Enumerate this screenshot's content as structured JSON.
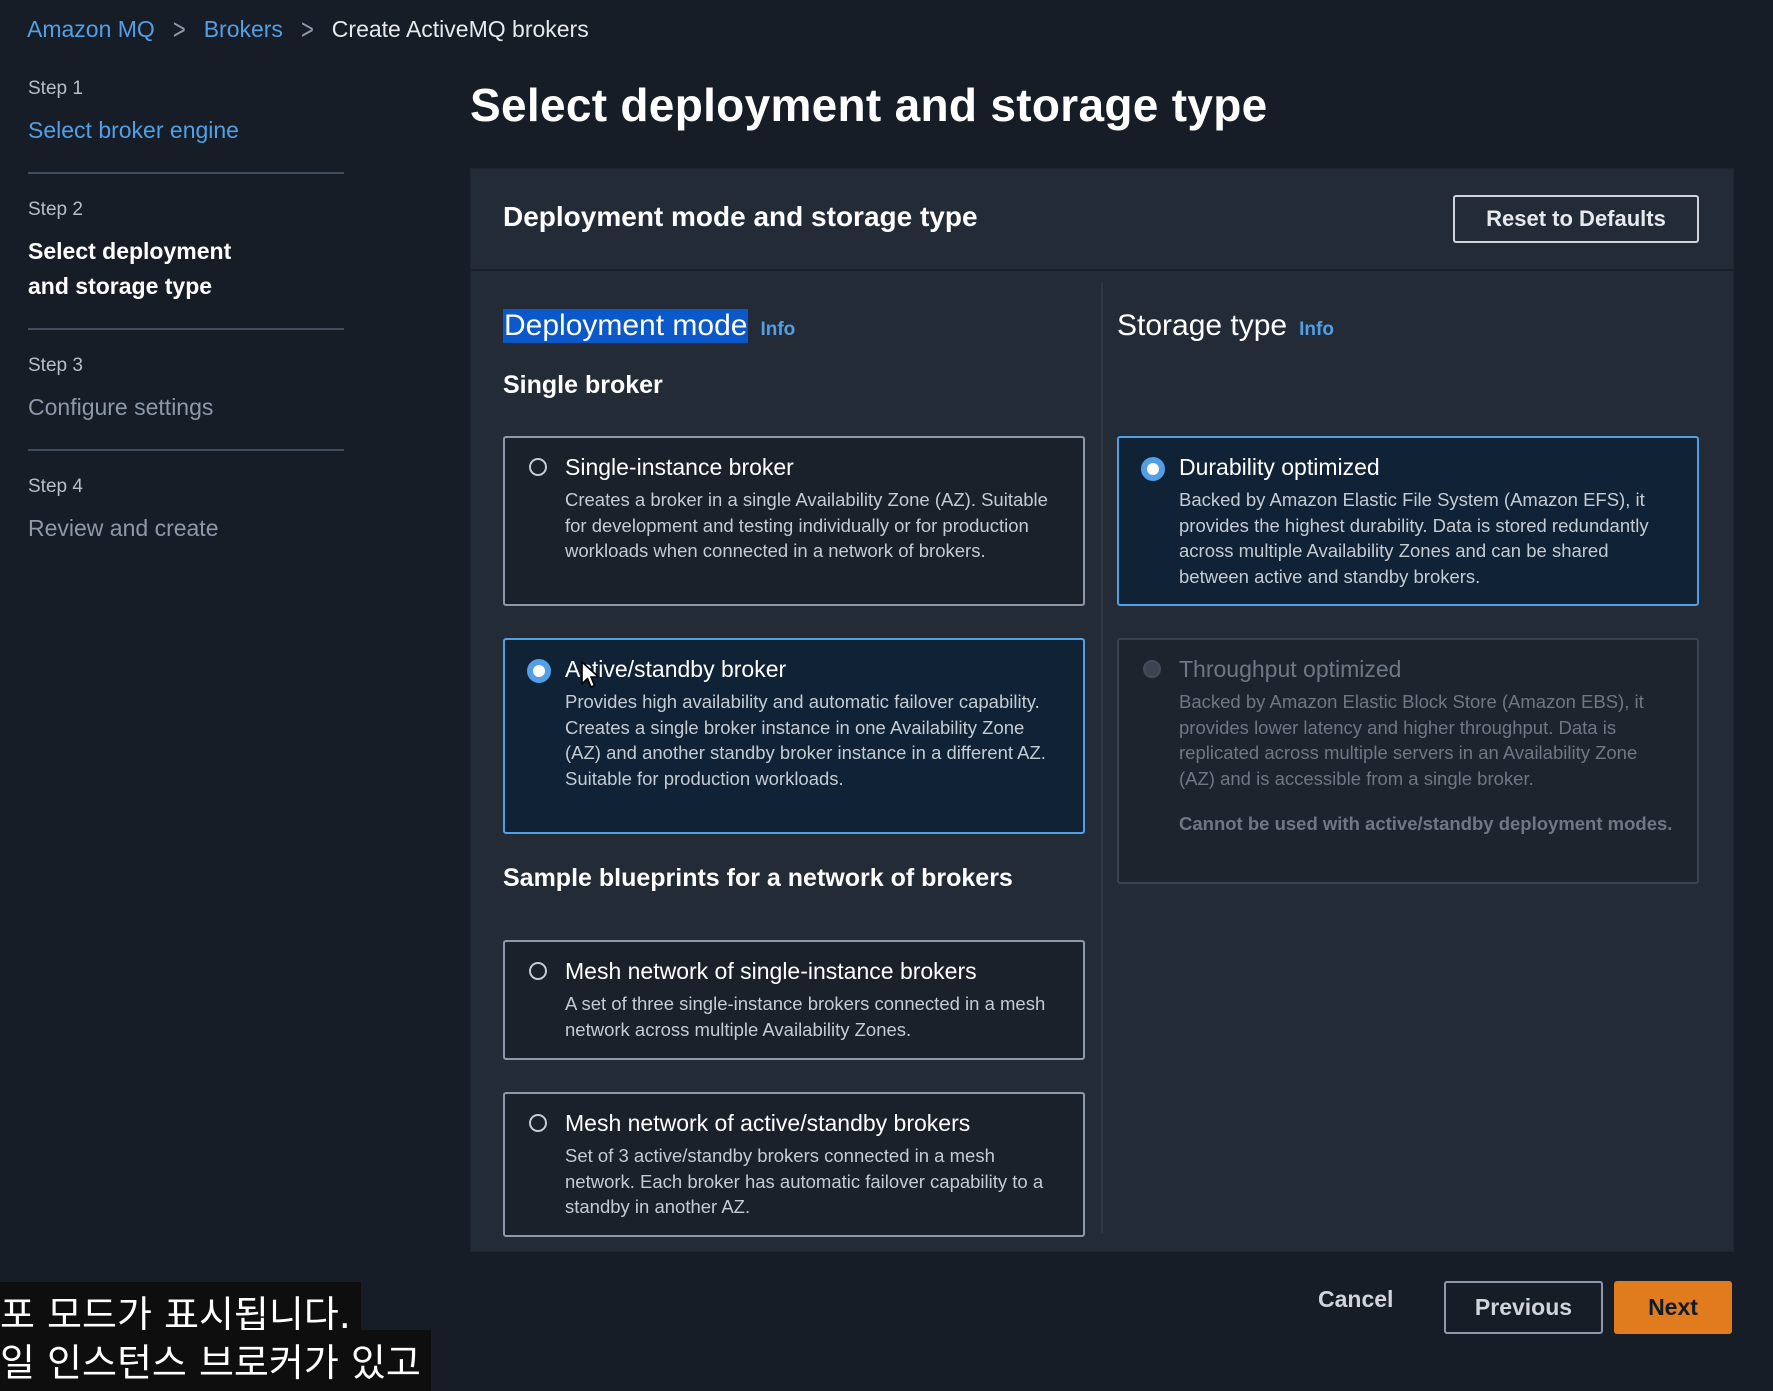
{
  "breadcrumb": {
    "items": [
      "Amazon MQ",
      "Brokers"
    ],
    "current": "Create ActiveMQ brokers"
  },
  "steps": [
    {
      "num": "Step 1",
      "title": "Select broker engine"
    },
    {
      "num": "Step 2",
      "title": "Select deployment and storage type"
    },
    {
      "num": "Step 3",
      "title": "Configure settings"
    },
    {
      "num": "Step 4",
      "title": "Review and create"
    }
  ],
  "page_title": "Select deployment and storage type",
  "container": {
    "title": "Deployment mode and storage type",
    "reset_label": "Reset to Defaults"
  },
  "deployment": {
    "label": "Deployment mode",
    "info": "Info",
    "single_head": "Single broker",
    "options": [
      {
        "title": "Single-instance broker",
        "desc": "Creates a broker in a single Availability Zone (AZ). Suitable for development and testing individually or for production workloads when connected in a network of brokers.",
        "selected": false
      },
      {
        "title": "Active/standby broker",
        "desc": "Provides high availability and automatic failover capability. Creates a single broker instance in one Availability Zone (AZ) and another standby broker instance in a different AZ. Suitable for production workloads.",
        "selected": true
      }
    ],
    "blueprint_head": "Sample blueprints for a network of brokers",
    "blueprints": [
      {
        "title": "Mesh network of single-instance brokers",
        "desc": "A set of three single-instance brokers connected in a mesh network across multiple Availability Zones.",
        "selected": false
      },
      {
        "title": "Mesh network of active/standby brokers",
        "desc": "Set of 3 active/standby brokers connected in a mesh network. Each broker has automatic failover capability to a standby in another AZ.",
        "selected": false
      }
    ]
  },
  "storage": {
    "label": "Storage type",
    "info": "Info",
    "options": [
      {
        "title": "Durability optimized",
        "desc": "Backed by Amazon Elastic File System (Amazon EFS), it provides the highest durability. Data is stored redundantly across multiple Availability Zones and can be shared between active and standby brokers.",
        "selected": true
      },
      {
        "title": "Throughput optimized",
        "desc": "Backed by Amazon Elastic Block Store (Amazon EBS), it provides lower latency and higher throughput. Data is replicated across multiple servers in an Availability Zone (AZ) and is accessible from a single broker.",
        "note": "Cannot be used with active/standby deployment modes.",
        "selected": false,
        "disabled": true
      }
    ]
  },
  "footer": {
    "cancel": "Cancel",
    "previous": "Previous",
    "next": "Next"
  },
  "subtitles": [
    "포 모드가 표시됩니다.",
    "일 인스턴스 브로커가 있고"
  ]
}
